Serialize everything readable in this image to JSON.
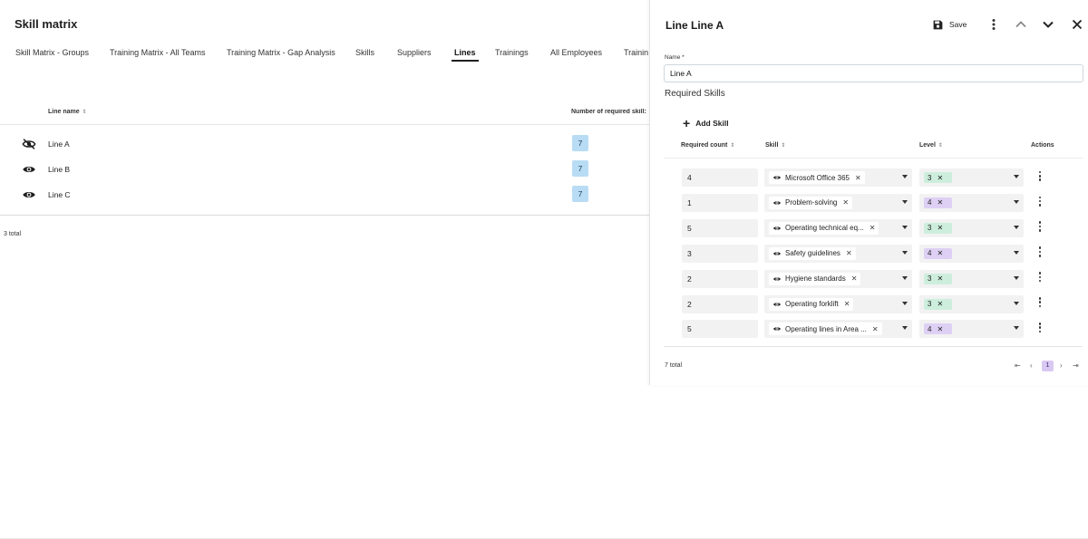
{
  "app": {
    "title": "Skill matrix"
  },
  "tabs": [
    {
      "label": "Skill Matrix - Groups",
      "active": false
    },
    {
      "label": "Training Matrix - All Teams",
      "active": false
    },
    {
      "label": "Training Matrix - Gap Analysis",
      "active": false
    },
    {
      "label": "Skills",
      "active": false
    },
    {
      "label": "Suppliers",
      "active": false
    },
    {
      "label": "Lines",
      "active": true
    },
    {
      "label": "Trainings",
      "active": false
    },
    {
      "label": "All Employees",
      "active": false
    },
    {
      "label": "Trainin",
      "active": false
    }
  ],
  "lines_table": {
    "columns": {
      "line_name": "Line name",
      "required_skills": "Number of required skill:"
    },
    "rows": [
      {
        "icon": "eye-off-icon",
        "name": "Line A",
        "count": "7"
      },
      {
        "icon": "eye-icon",
        "name": "Line B",
        "count": "7"
      },
      {
        "icon": "eye-icon",
        "name": "Line C",
        "count": "7"
      }
    ],
    "total": "3 total"
  },
  "panel": {
    "title": "Line Line A",
    "save_label": "Save",
    "name_label": "Name *",
    "name_value": "Line A",
    "section_title": "Required Skills",
    "add_skill_label": "Add Skill",
    "columns": {
      "required_count": "Required count",
      "skill": "Skill",
      "level": "Level",
      "actions": "Actions"
    },
    "skills": [
      {
        "count": "4",
        "skill": "Microsoft Office 365",
        "level": "3"
      },
      {
        "count": "1",
        "skill": "Problem-solving",
        "level": "4"
      },
      {
        "count": "5",
        "skill": "Operating technical eq...",
        "level": "3"
      },
      {
        "count": "3",
        "skill": "Safety guidelines",
        "level": "4"
      },
      {
        "count": "2",
        "skill": "Hygiene standards",
        "level": "3"
      },
      {
        "count": "2",
        "skill": "Operating forklift",
        "level": "3"
      },
      {
        "count": "5",
        "skill": "Operating lines in Area ...",
        "level": "4"
      }
    ],
    "total": "7 total",
    "pager": {
      "current_page": "1"
    }
  },
  "colors": {
    "count_badge": "#b9dcf5",
    "level_3": "#cdeedd",
    "level_4": "#ddd0f4",
    "page_current": "#d9c8f2"
  }
}
